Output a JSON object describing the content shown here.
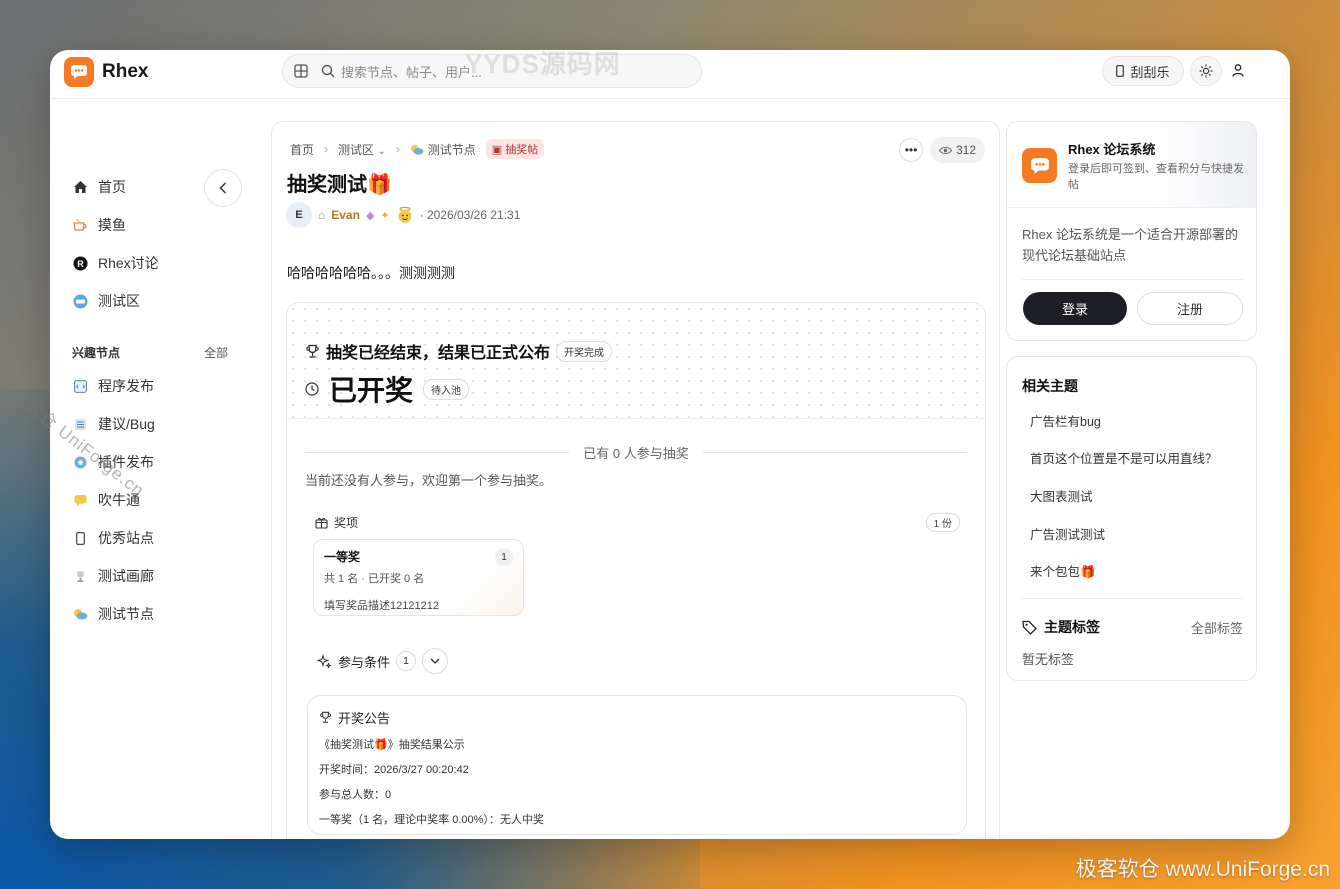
{
  "header": {
    "brand": "Rhex",
    "search_placeholder": "搜索节点、帖子、用户...",
    "watermark": "YYDS源码网",
    "scratch_label": "刮刮乐"
  },
  "sidebar": {
    "items": [
      {
        "label": "首页",
        "icon": "home-icon"
      },
      {
        "label": "摸鱼",
        "icon": "coffee-icon"
      },
      {
        "label": "Rhex讨论",
        "icon": "rhex-icon"
      },
      {
        "label": "测试区",
        "icon": "test-icon"
      }
    ],
    "section_title": "兴趣节点",
    "section_all": "全部",
    "nodes": [
      {
        "label": "程序发布"
      },
      {
        "label": "建议/Bug"
      },
      {
        "label": "插件发布"
      },
      {
        "label": "吹牛通"
      },
      {
        "label": "优秀站点"
      },
      {
        "label": "测试画廊"
      },
      {
        "label": "测试节点"
      }
    ]
  },
  "post": {
    "breadcrumb": [
      "首页",
      "测试区",
      "测试节点"
    ],
    "tag": "抽奖帖",
    "views": "312",
    "title": "抽奖测试🎁",
    "author_initial": "E",
    "author": "Evan",
    "date": "· 2026/03/26 21:31",
    "body": "哈哈哈哈哈哈。。。测测测测"
  },
  "lottery": {
    "status": "抽奖已经结束，结果已正式公布",
    "status_pill": "开奖完成",
    "big": "已开奖",
    "big_pill": "待入池",
    "participants": "已有 0 人参与抽奖",
    "empty_note": "当前还没有人参与，欢迎第一个参与抽奖。",
    "prizes_label": "奖项",
    "prizes_count": "1 份",
    "prize": {
      "name": "一等奖",
      "index": "1",
      "stat": "共 1 名 · 已开奖 0 名",
      "desc": "填写奖品描述12121212"
    },
    "conditions_label": "参与条件",
    "conditions_count": "1",
    "announcement": {
      "title": "开奖公告",
      "lines": [
        "《抽奖测试🎁》抽奖结果公示",
        "开奖时间：2026/3/27 00:20:42",
        "参与总人数：0",
        "一等奖（1 名，理论中奖率 0.00%）：无人中奖"
      ]
    }
  },
  "right": {
    "site_name": "Rhex 论坛系统",
    "site_sub": "登录后即可签到、查看积分与快捷发帖",
    "site_desc": "Rhex 论坛系统是一个适合开源部署的现代论坛基础站点",
    "login": "登录",
    "register": "注册",
    "related_title": "相关主题",
    "topics": [
      "广告栏有bug",
      "首页这个位置是不是可以用直线？",
      "大图表测试",
      "广告测试测试",
      "来个包包🎁"
    ],
    "tags_title": "主题标签",
    "tags_all": "全部标签",
    "no_tags": "暂无标签"
  },
  "watermarks": {
    "diagonal": "极客软仓 UniForge.cn",
    "bottom": "极客软仓 www.UniForge.cn"
  },
  "colors": {
    "accent": "#f47a24",
    "dark_button": "#1d1f24",
    "author": "#b07a14"
  }
}
